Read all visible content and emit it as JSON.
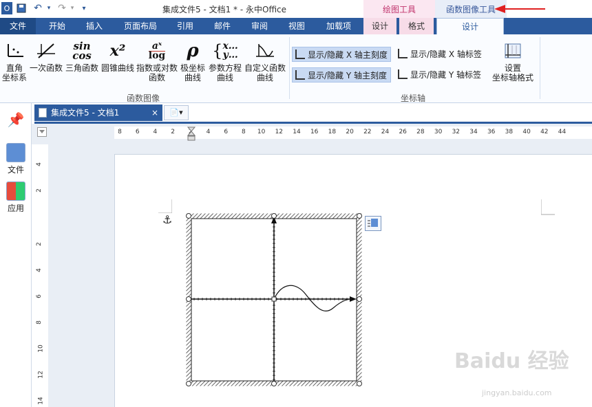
{
  "app": {
    "title": "集成文件5 - 文档1 *  - 永中Office"
  },
  "contextual_tabs": {
    "drawing_tools": "绘图工具",
    "function_image_tools": "函数图像工具"
  },
  "tabs": [
    "文件",
    "开始",
    "插入",
    "页面布局",
    "引用",
    "邮件",
    "审阅",
    "视图",
    "加载项",
    "设计",
    "格式",
    "设计"
  ],
  "ribbon": {
    "function_group": {
      "label": "函数图像",
      "buttons": [
        {
          "icon_text": "↕·",
          "label1": "直角",
          "label2": "坐标系"
        },
        {
          "icon_text": "⁄",
          "label1": "一次函数",
          "label2": ""
        },
        {
          "icon_text": "sin cos",
          "label1": "三角函数",
          "label2": ""
        },
        {
          "icon_text": "x²",
          "label1": "圆锥曲线",
          "label2": ""
        },
        {
          "icon_text": "aˣ log",
          "label1": "指数或对数",
          "label2": "函数"
        },
        {
          "icon_text": "ρ",
          "label1": "极坐标",
          "label2": "曲线"
        },
        {
          "icon_text": "{x… y…",
          "label1": "参数方程",
          "label2": "曲线"
        },
        {
          "icon_text": "∿",
          "label1": "自定义函数",
          "label2": "曲线"
        }
      ]
    },
    "axis_group": {
      "label": "坐标轴",
      "toggle_x_ticks": "显示/隐藏 X 轴主刻度",
      "toggle_y_ticks": "显示/隐藏 Y 轴主刻度",
      "toggle_x_labels": "显示/隐藏 X 轴标签",
      "toggle_y_labels": "显示/隐藏 Y 轴标签",
      "axis_format_line1": "设置",
      "axis_format_line2": "坐标轴格式"
    }
  },
  "left_panel": {
    "items": [
      "文件",
      "应用"
    ]
  },
  "doc_tab": {
    "title": "集成文件5 - 文档1",
    "close": "×"
  },
  "ruler": {
    "h_numbers": [
      "8",
      "6",
      "4",
      "2",
      "2",
      "4",
      "6",
      "8",
      "10",
      "12",
      "14",
      "16",
      "18",
      "20",
      "22",
      "24",
      "26",
      "28",
      "30",
      "32",
      "34",
      "36",
      "38",
      "40",
      "42",
      "44"
    ],
    "v_numbers": [
      "4",
      "2",
      "2",
      "4",
      "6",
      "8",
      "10",
      "12",
      "14"
    ]
  },
  "watermark": {
    "line1": "Baidu 经验",
    "line2": "jingyan.baidu.com"
  },
  "colors": {
    "accent": "#2c5b9e",
    "arrow": "#e02020"
  }
}
